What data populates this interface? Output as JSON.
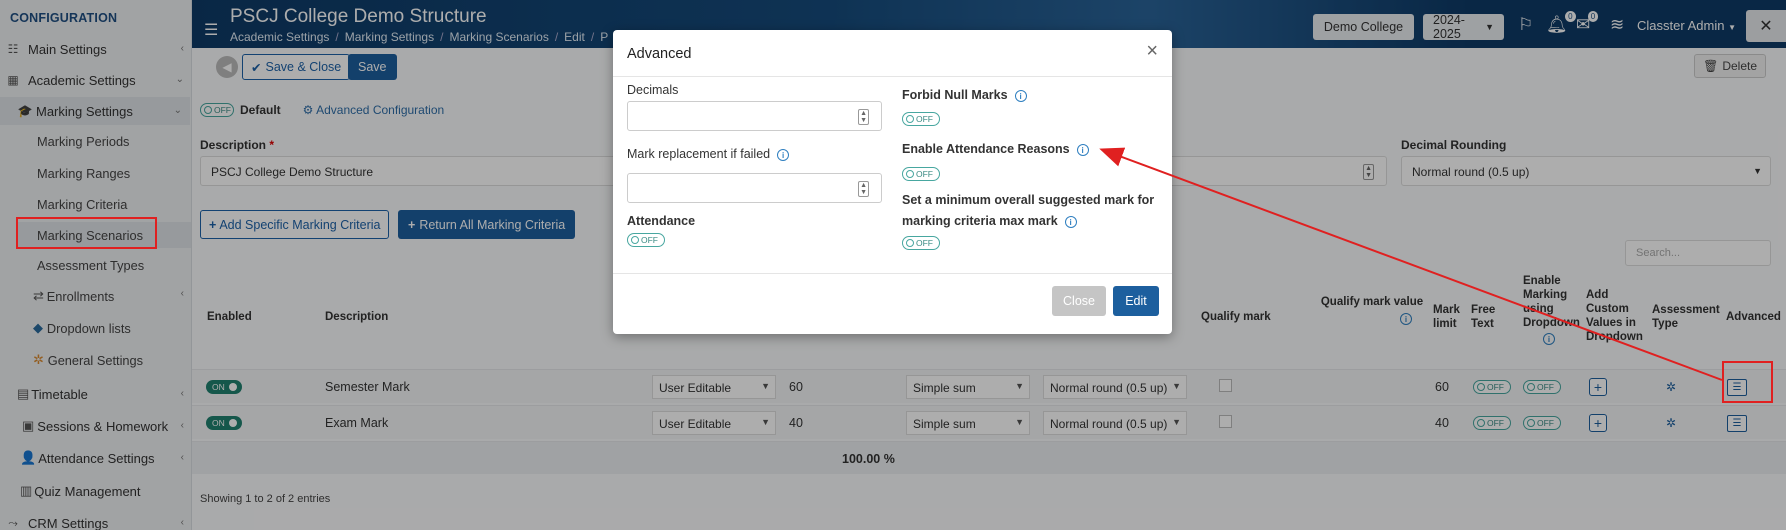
{
  "sidebar": {
    "heading": "CONFIGURATION",
    "items": [
      {
        "label": "Main Settings",
        "icon": "sliders-icon"
      },
      {
        "label": "Academic Settings",
        "icon": "grid-icon"
      },
      {
        "label": "Marking Settings",
        "icon": "graduation-cap-icon"
      }
    ],
    "sub_items": [
      "Marking Periods",
      "Marking Ranges",
      "Marking Criteria",
      "Marking Scenarios",
      "Assessment Types"
    ],
    "more_items": [
      {
        "label": "Enrollments",
        "icon": "swap-icon"
      },
      {
        "label": "Dropdown lists",
        "icon": "layers-icon"
      },
      {
        "label": "General Settings",
        "icon": "gear-icon"
      },
      {
        "label": "Timetable",
        "icon": "calendar-icon"
      },
      {
        "label": "Sessions & Homework",
        "icon": "board-icon"
      },
      {
        "label": "Attendance Settings",
        "icon": "user-check-icon"
      },
      {
        "label": "Quiz Management",
        "icon": "quiz-icon"
      },
      {
        "label": "CRM Settings",
        "icon": "crm-icon"
      }
    ]
  },
  "header": {
    "title": "PSCJ College Demo Structure",
    "breadcrumbs": [
      "Academic Settings",
      "Marking Settings",
      "Marking Scenarios",
      "Edit",
      "P"
    ],
    "school": "Demo College",
    "year": "2024-2025",
    "notif_count": "0",
    "msg_count": "0",
    "user": "Classter Admin"
  },
  "toolbar": {
    "save_close": "Save & Close",
    "save": "Save",
    "delete": "Delete"
  },
  "form": {
    "default_toggle": "OFF",
    "default_label": "Default",
    "advanced_config": "Advanced Configuration",
    "description_label": "Description",
    "required_mark": "*",
    "description_value": "PSCJ College Demo Structure",
    "decimal_rounding_label": "Decimal Rounding",
    "decimal_rounding_value": "Normal round (0.5 up)",
    "add_specific": "Add Specific Marking Criteria",
    "return_all": "Return All Marking Criteria",
    "search_placeholder": "Search..."
  },
  "table": {
    "headers": {
      "enabled": "Enabled",
      "description": "Description",
      "qualify_mark": "Qualify mark",
      "qualify_mark_value": "Qualify mark value",
      "mark_limit_1": "Mark",
      "mark_limit_2": "limit",
      "free_text_1": "Free",
      "free_text_2": "Text",
      "enable_dd_1": "Enable",
      "enable_dd_2": "Marking",
      "enable_dd_3": "using",
      "enable_dd_4": "Dropdown",
      "add_custom_1": "Add",
      "add_custom_2": "Custom",
      "add_custom_3": "Values in",
      "add_custom_4": "Dropdown",
      "assessment_1": "Assessment",
      "assessment_2": "Type",
      "advanced": "Advanced"
    },
    "rows": [
      {
        "enabled": "ON",
        "description": "Semester Mark",
        "mode": "User Editable",
        "weight": "60",
        "calc": "Simple sum",
        "round": "Normal round (0.5 up)",
        "limit": "60",
        "free_text": "OFF",
        "dropdown": "OFF"
      },
      {
        "enabled": "ON",
        "description": "Exam Mark",
        "mode": "User Editable",
        "weight": "40",
        "calc": "Simple sum",
        "round": "Normal round (0.5 up)",
        "limit": "40",
        "free_text": "OFF",
        "dropdown": "OFF"
      }
    ],
    "total": "100.00 %",
    "footer": "Showing 1 to 2 of 2 entries"
  },
  "modal": {
    "title": "Advanced",
    "decimals_label": "Decimals",
    "mark_replacement_label": "Mark replacement if failed",
    "attendance_label": "Attendance",
    "attendance_toggle": "OFF",
    "forbid_null_label": "Forbid Null Marks",
    "forbid_null_toggle": "OFF",
    "enable_attendance_reasons_label": "Enable Attendance Reasons",
    "enable_attendance_reasons_toggle": "OFF",
    "min_suggested_label_1": "Set a minimum overall suggested mark for",
    "min_suggested_label_2": "marking criteria max mark",
    "min_suggested_toggle": "OFF",
    "close_button": "Close",
    "edit_button": "Edit"
  },
  "colors": {
    "brand": "#164b7c",
    "primary_button": "#1d5f9e",
    "annotation": "#e02020"
  }
}
